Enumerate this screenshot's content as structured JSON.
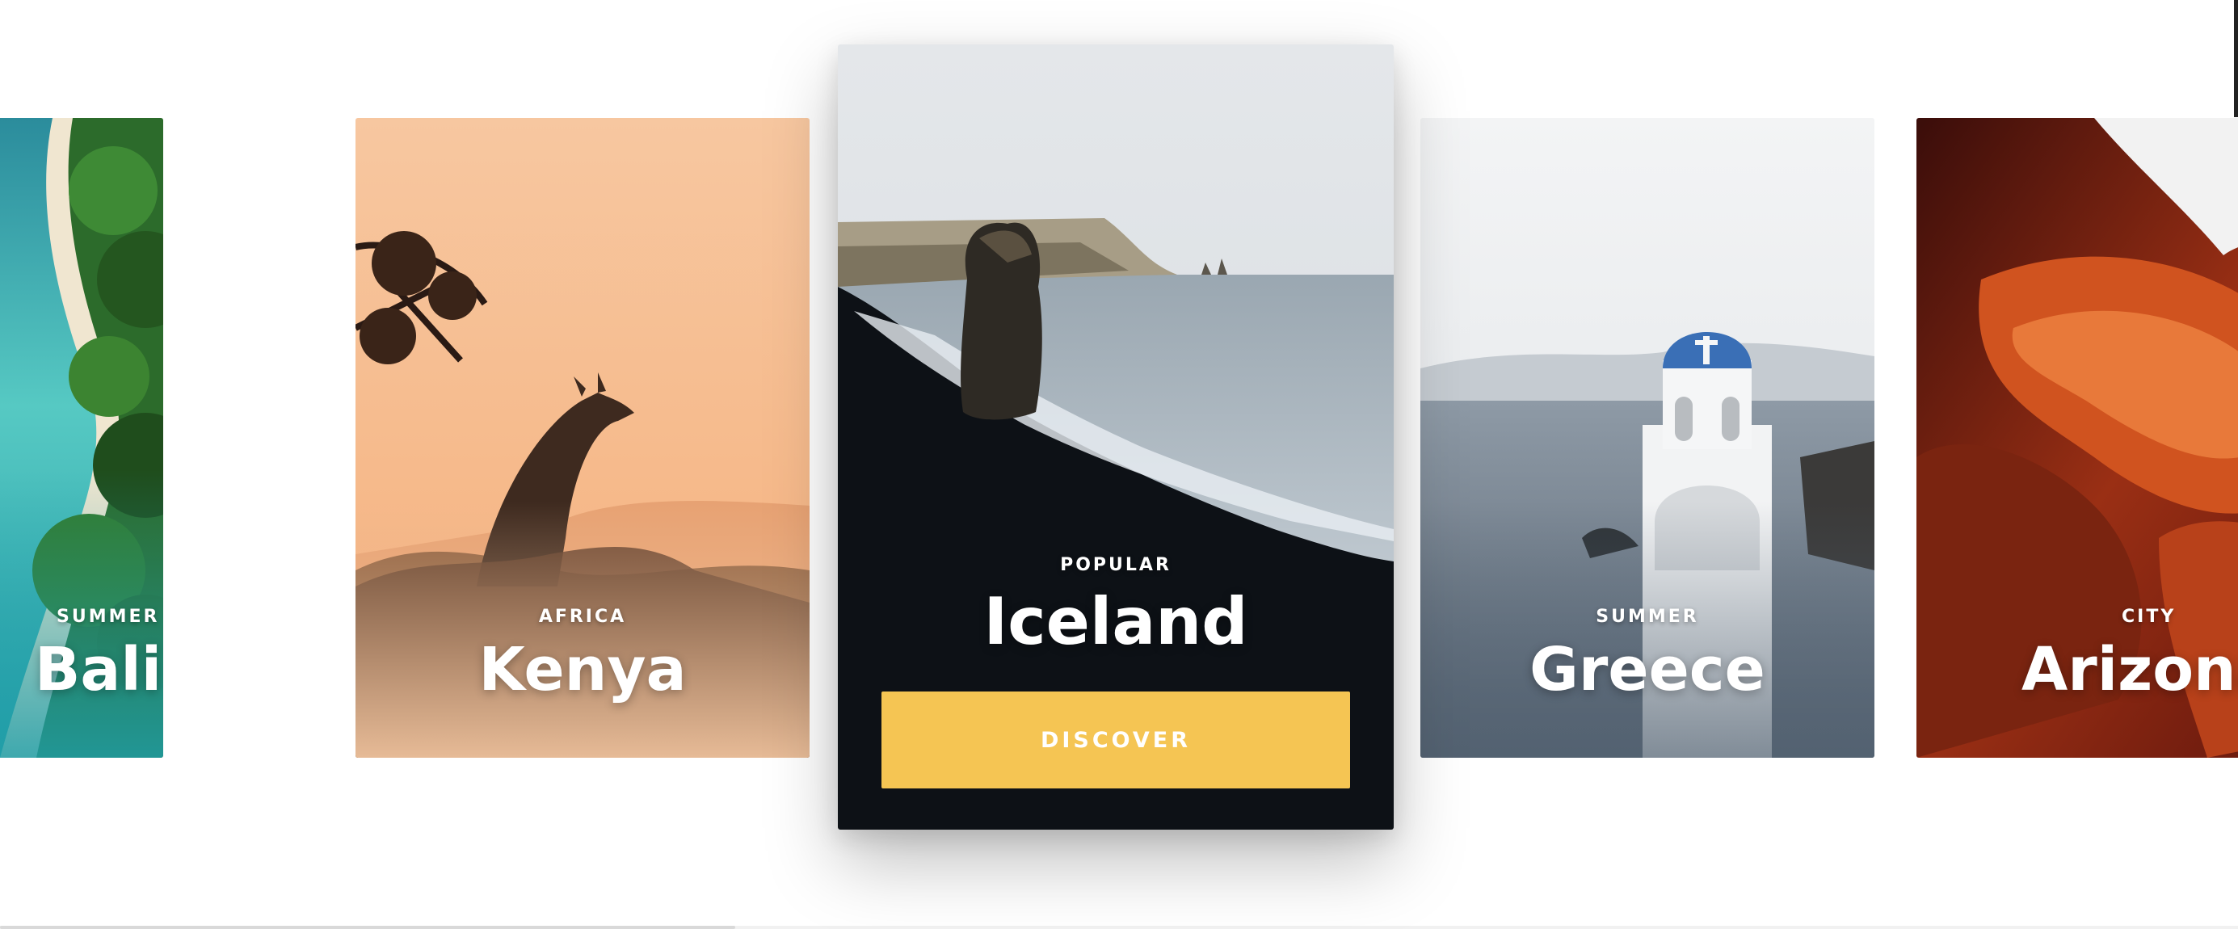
{
  "destinations": [
    {
      "category": "SUMMER",
      "name": "Bali"
    },
    {
      "category": "AFRICA",
      "name": "Kenya"
    },
    {
      "category": "POPULAR",
      "name": "Iceland",
      "action_label": "DISCOVER"
    },
    {
      "category": "SUMMER",
      "name": "Greece"
    },
    {
      "category": "CITY",
      "name": "Arizona"
    }
  ],
  "colors": {
    "discover_button": "#f5c553",
    "featured_card_background": "#0d1116",
    "kenya_sky": "#f8c9a1",
    "bali_water": "#3fc0c4",
    "arizona_rock": "#c0421c"
  }
}
